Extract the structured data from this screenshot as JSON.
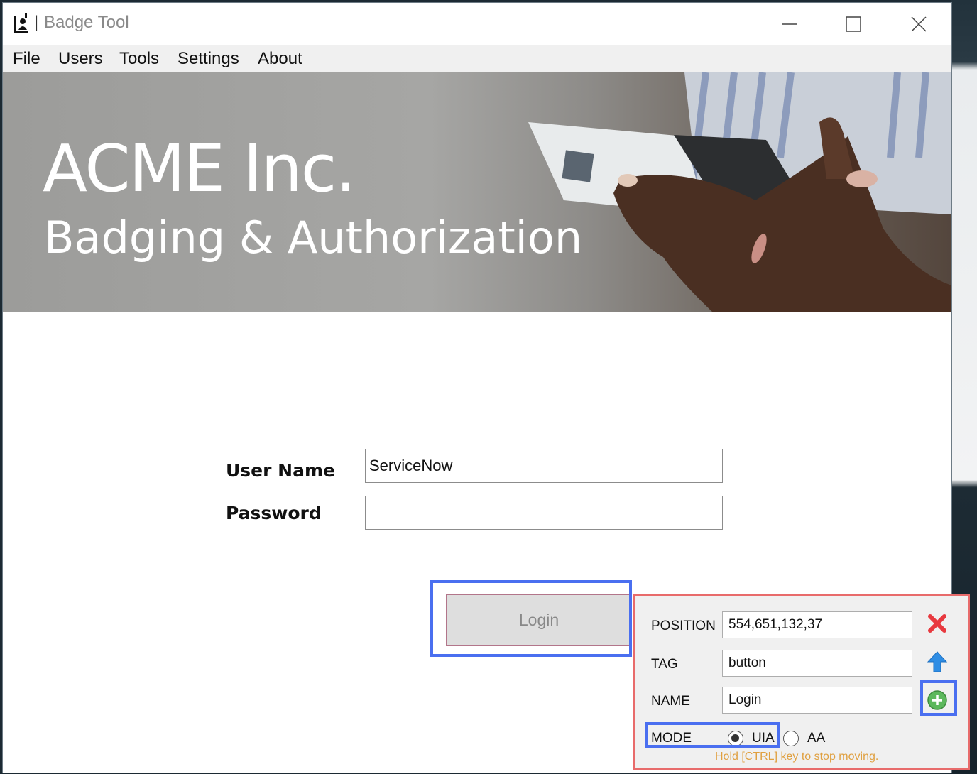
{
  "window": {
    "title_separator": "|",
    "title": "Badge Tool"
  },
  "menu": {
    "items": [
      "File",
      "Users",
      "Tools",
      "Settings",
      "About"
    ]
  },
  "banner": {
    "title": "ACME Inc.",
    "subtitle": "Badging & Authorization"
  },
  "login_form": {
    "username_label": "User Name",
    "username_value": "ServiceNow",
    "password_label": "Password",
    "password_value": "",
    "login_button": "Login"
  },
  "inspector": {
    "position_label": "POSITION",
    "position_value": "554,651,132,37",
    "tag_label": "TAG",
    "tag_value": "button",
    "name_label": "NAME",
    "name_value": "Login",
    "mode_label": "MODE",
    "mode_options": [
      "UIA",
      "AA"
    ],
    "mode_selected": "UIA",
    "hint": "Hold [CTRL] key to stop moving."
  },
  "icons": {
    "app": "badge-user-icon",
    "minimize": "minimize-icon",
    "maximize": "maximize-icon",
    "close": "close-icon",
    "delete": "red-x-icon",
    "parent": "blue-up-arrow-icon",
    "add": "green-plus-icon"
  },
  "colors": {
    "highlight": "#4a6ff0",
    "inspector_border": "#e86b6b",
    "hint": "#e0a040"
  }
}
